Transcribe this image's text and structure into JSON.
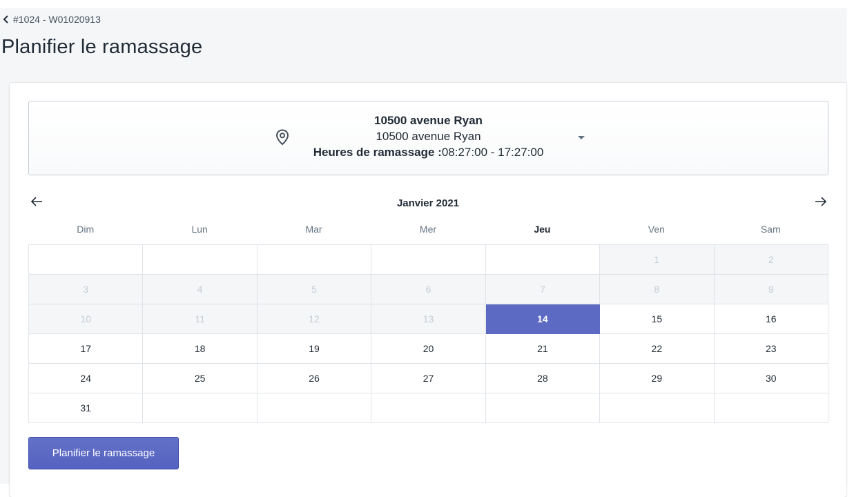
{
  "breadcrumb": {
    "label": "#1024 - W01020913",
    "icon": "chevron-left-icon"
  },
  "page": {
    "title": "Planifier le ramassage"
  },
  "location": {
    "name": "10500 avenue Ryan",
    "address": "10500 avenue Ryan",
    "hours_label": "Heures de ramassage :",
    "hours_value": "08:27:00 - 17:27:00",
    "icon": "location-pin-icon"
  },
  "calendar": {
    "month_label": "Janvier 2021",
    "prev_icon": "arrow-left-icon",
    "next_icon": "arrow-right-icon",
    "weekdays": [
      "Dim",
      "Lun",
      "Mar",
      "Mer",
      "Jeu",
      "Ven",
      "Sam"
    ],
    "current_weekday": "Jeu",
    "selected_day": "14",
    "weeks": [
      [
        {
          "day": "",
          "state": "empty"
        },
        {
          "day": "",
          "state": "empty"
        },
        {
          "day": "",
          "state": "empty"
        },
        {
          "day": "",
          "state": "empty"
        },
        {
          "day": "",
          "state": "empty"
        },
        {
          "day": "1",
          "state": "disabled"
        },
        {
          "day": "2",
          "state": "disabled"
        }
      ],
      [
        {
          "day": "3",
          "state": "disabled"
        },
        {
          "day": "4",
          "state": "disabled"
        },
        {
          "day": "5",
          "state": "disabled"
        },
        {
          "day": "6",
          "state": "disabled"
        },
        {
          "day": "7",
          "state": "disabled"
        },
        {
          "day": "8",
          "state": "disabled"
        },
        {
          "day": "9",
          "state": "disabled"
        }
      ],
      [
        {
          "day": "10",
          "state": "disabled"
        },
        {
          "day": "11",
          "state": "disabled"
        },
        {
          "day": "12",
          "state": "disabled"
        },
        {
          "day": "13",
          "state": "disabled"
        },
        {
          "day": "14",
          "state": "selected"
        },
        {
          "day": "15",
          "state": "available"
        },
        {
          "day": "16",
          "state": "available"
        }
      ],
      [
        {
          "day": "17",
          "state": "available"
        },
        {
          "day": "18",
          "state": "available"
        },
        {
          "day": "19",
          "state": "available"
        },
        {
          "day": "20",
          "state": "available"
        },
        {
          "day": "21",
          "state": "available"
        },
        {
          "day": "22",
          "state": "available"
        },
        {
          "day": "23",
          "state": "available"
        }
      ],
      [
        {
          "day": "24",
          "state": "available"
        },
        {
          "day": "25",
          "state": "available"
        },
        {
          "day": "26",
          "state": "available"
        },
        {
          "day": "27",
          "state": "available"
        },
        {
          "day": "28",
          "state": "available"
        },
        {
          "day": "29",
          "state": "available"
        },
        {
          "day": "30",
          "state": "available"
        }
      ],
      [
        {
          "day": "31",
          "state": "available"
        },
        {
          "day": "",
          "state": "empty"
        },
        {
          "day": "",
          "state": "empty"
        },
        {
          "day": "",
          "state": "empty"
        },
        {
          "day": "",
          "state": "empty"
        },
        {
          "day": "",
          "state": "empty"
        },
        {
          "day": "",
          "state": "empty"
        }
      ]
    ]
  },
  "actions": {
    "submit_label": "Planifier le ramassage"
  },
  "colors": {
    "accent": "#5c6ac4",
    "page_background": "#f4f6f8",
    "disabled_cell": "#f4f6f8",
    "border": "#dfe3e8"
  }
}
